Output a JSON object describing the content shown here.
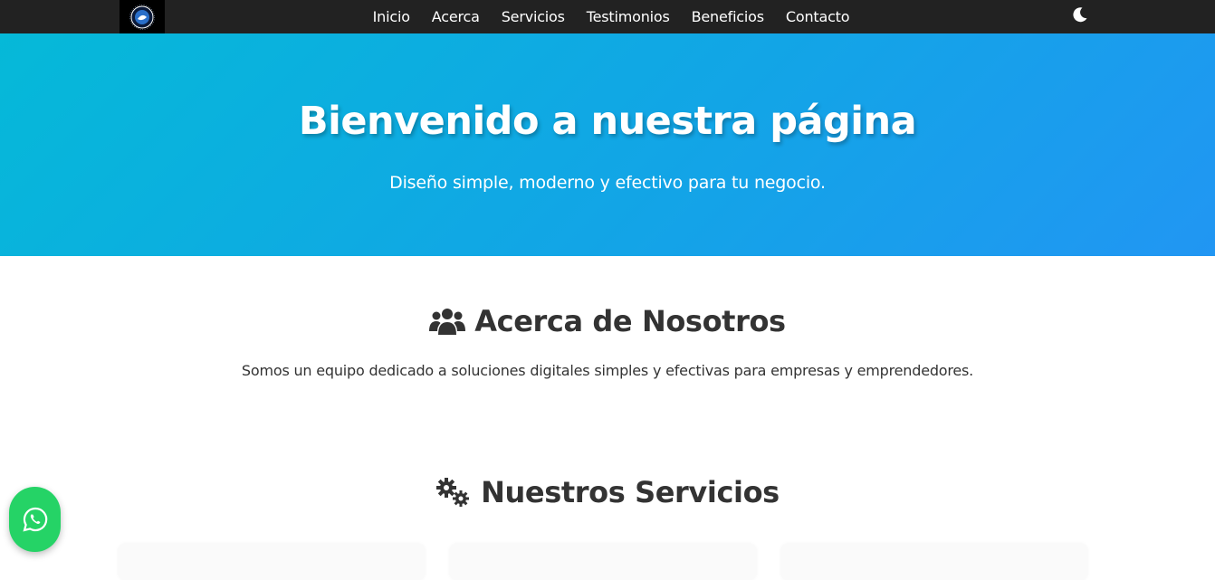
{
  "nav": {
    "logo_icon": "brand-logo",
    "links": [
      "Inicio",
      "Acerca",
      "Servicios",
      "Testimonios",
      "Beneficios",
      "Contacto"
    ],
    "theme_icon": "moon-icon"
  },
  "hero": {
    "title": "Bienvenido a nuestra página",
    "subtitle": "Diseño simple, moderno y efectivo para tu negocio.",
    "gradient_start": "#05b9d8",
    "gradient_end": "#2196f3"
  },
  "about": {
    "icon": "users-icon",
    "title": "Acerca de Nosotros",
    "text": "Somos un equipo dedicado a soluciones digitales simples y efectivas para empresas y emprendedores."
  },
  "services": {
    "icon": "gears-icon",
    "title": "Nuestros Servicios"
  },
  "whatsapp": {
    "icon": "whatsapp-icon",
    "color": "#25d366"
  }
}
